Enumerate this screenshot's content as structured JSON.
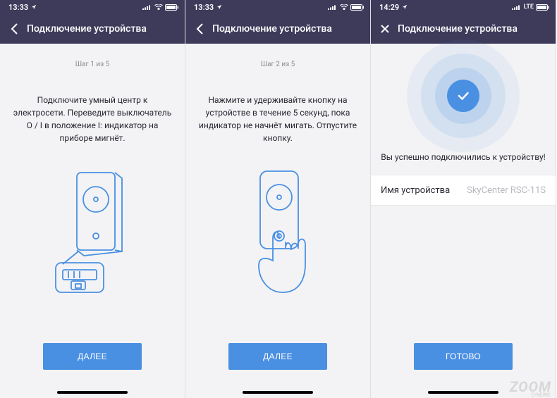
{
  "screens": [
    {
      "status": {
        "time": "13:33",
        "network": "Wi-Fi"
      },
      "header": {
        "back": "chevron-left",
        "title": "Подключение устройства"
      },
      "step": "Шаг 1 из 5",
      "description": "Подключите умный центр к электросети. Переведите выключатель O / I в положение I: индикатор на приборе мигнёт.",
      "button": "ДАЛЕЕ"
    },
    {
      "status": {
        "time": "13:33",
        "network": "Wi-Fi"
      },
      "header": {
        "back": "chevron-left",
        "title": "Подключение устройства"
      },
      "step": "Шаг 2 из 5",
      "description": "Нажмите и удерживайте кнопку на устройстве в течение 5 секунд, пока индикатор не начнёт мигать. Отпустите кнопку.",
      "button": "ДАЛЕЕ"
    },
    {
      "status": {
        "time": "14:29",
        "network": "LTE"
      },
      "header": {
        "back": "close",
        "title": "Подключение устройства"
      },
      "success_text": "Вы успешно подключились к устройству!",
      "field": {
        "label": "Имя устройства",
        "value": "SkyCenter RSC-11S"
      },
      "button": "ГОТОВО"
    }
  ],
  "colors": {
    "primary": "#4a90e2",
    "header": "#3d3a5a"
  },
  "watermark": {
    "main": "ZOOM",
    "sub": "C•NEWS"
  }
}
